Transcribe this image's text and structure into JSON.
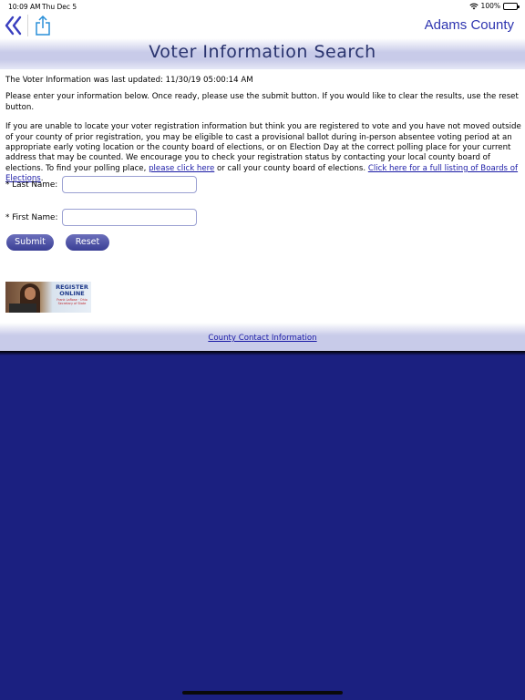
{
  "status_bar": {
    "time": "10:09 AM",
    "date": "Thu Dec 5",
    "battery": "100%"
  },
  "nav": {
    "title": "Adams County"
  },
  "page": {
    "title": "Voter Information Search",
    "updated_text": "The Voter Information was last updated: 11/30/19 05:00:14 AM",
    "instructions": "Please enter your information below. Once ready, please use the submit button. If you would like to clear the results, use the reset button.",
    "info_text": "If you are unable to locate your voter registration information but think you are registered to vote and you have not moved outside of your county of prior registration, you may be eligible to cast a provisional ballot during in-person absentee voting period at an appropriate early voting location or the county board of elections, or on Election Day at the correct polling place for your current address that may be counted. We encourage you to check your registration status by contacting your local county board of elections. To find your polling place,",
    "click_here_link": "please click here",
    "or_call_text": " or call your county board of elections. ",
    "full_listing_link": "Click here for a full listing of Boards of Elections",
    "period": "."
  },
  "form": {
    "last_name_label": "* Last Name:",
    "last_name_value": "",
    "first_name_label": "* First Name:",
    "first_name_value": "",
    "submit_label": "Submit",
    "reset_label": "Reset"
  },
  "banner": {
    "line1": "REGISTER",
    "line2": "ONLINE",
    "sub": "Frank LaRose · Ohio Secretary of State"
  },
  "footer": {
    "link": "County Contact Information"
  },
  "colors": {
    "accent": "#2e35b0",
    "title": "#29336e",
    "button": "#3a3f95",
    "band": "#c8cbe9",
    "background_blue": "#1b2080"
  }
}
